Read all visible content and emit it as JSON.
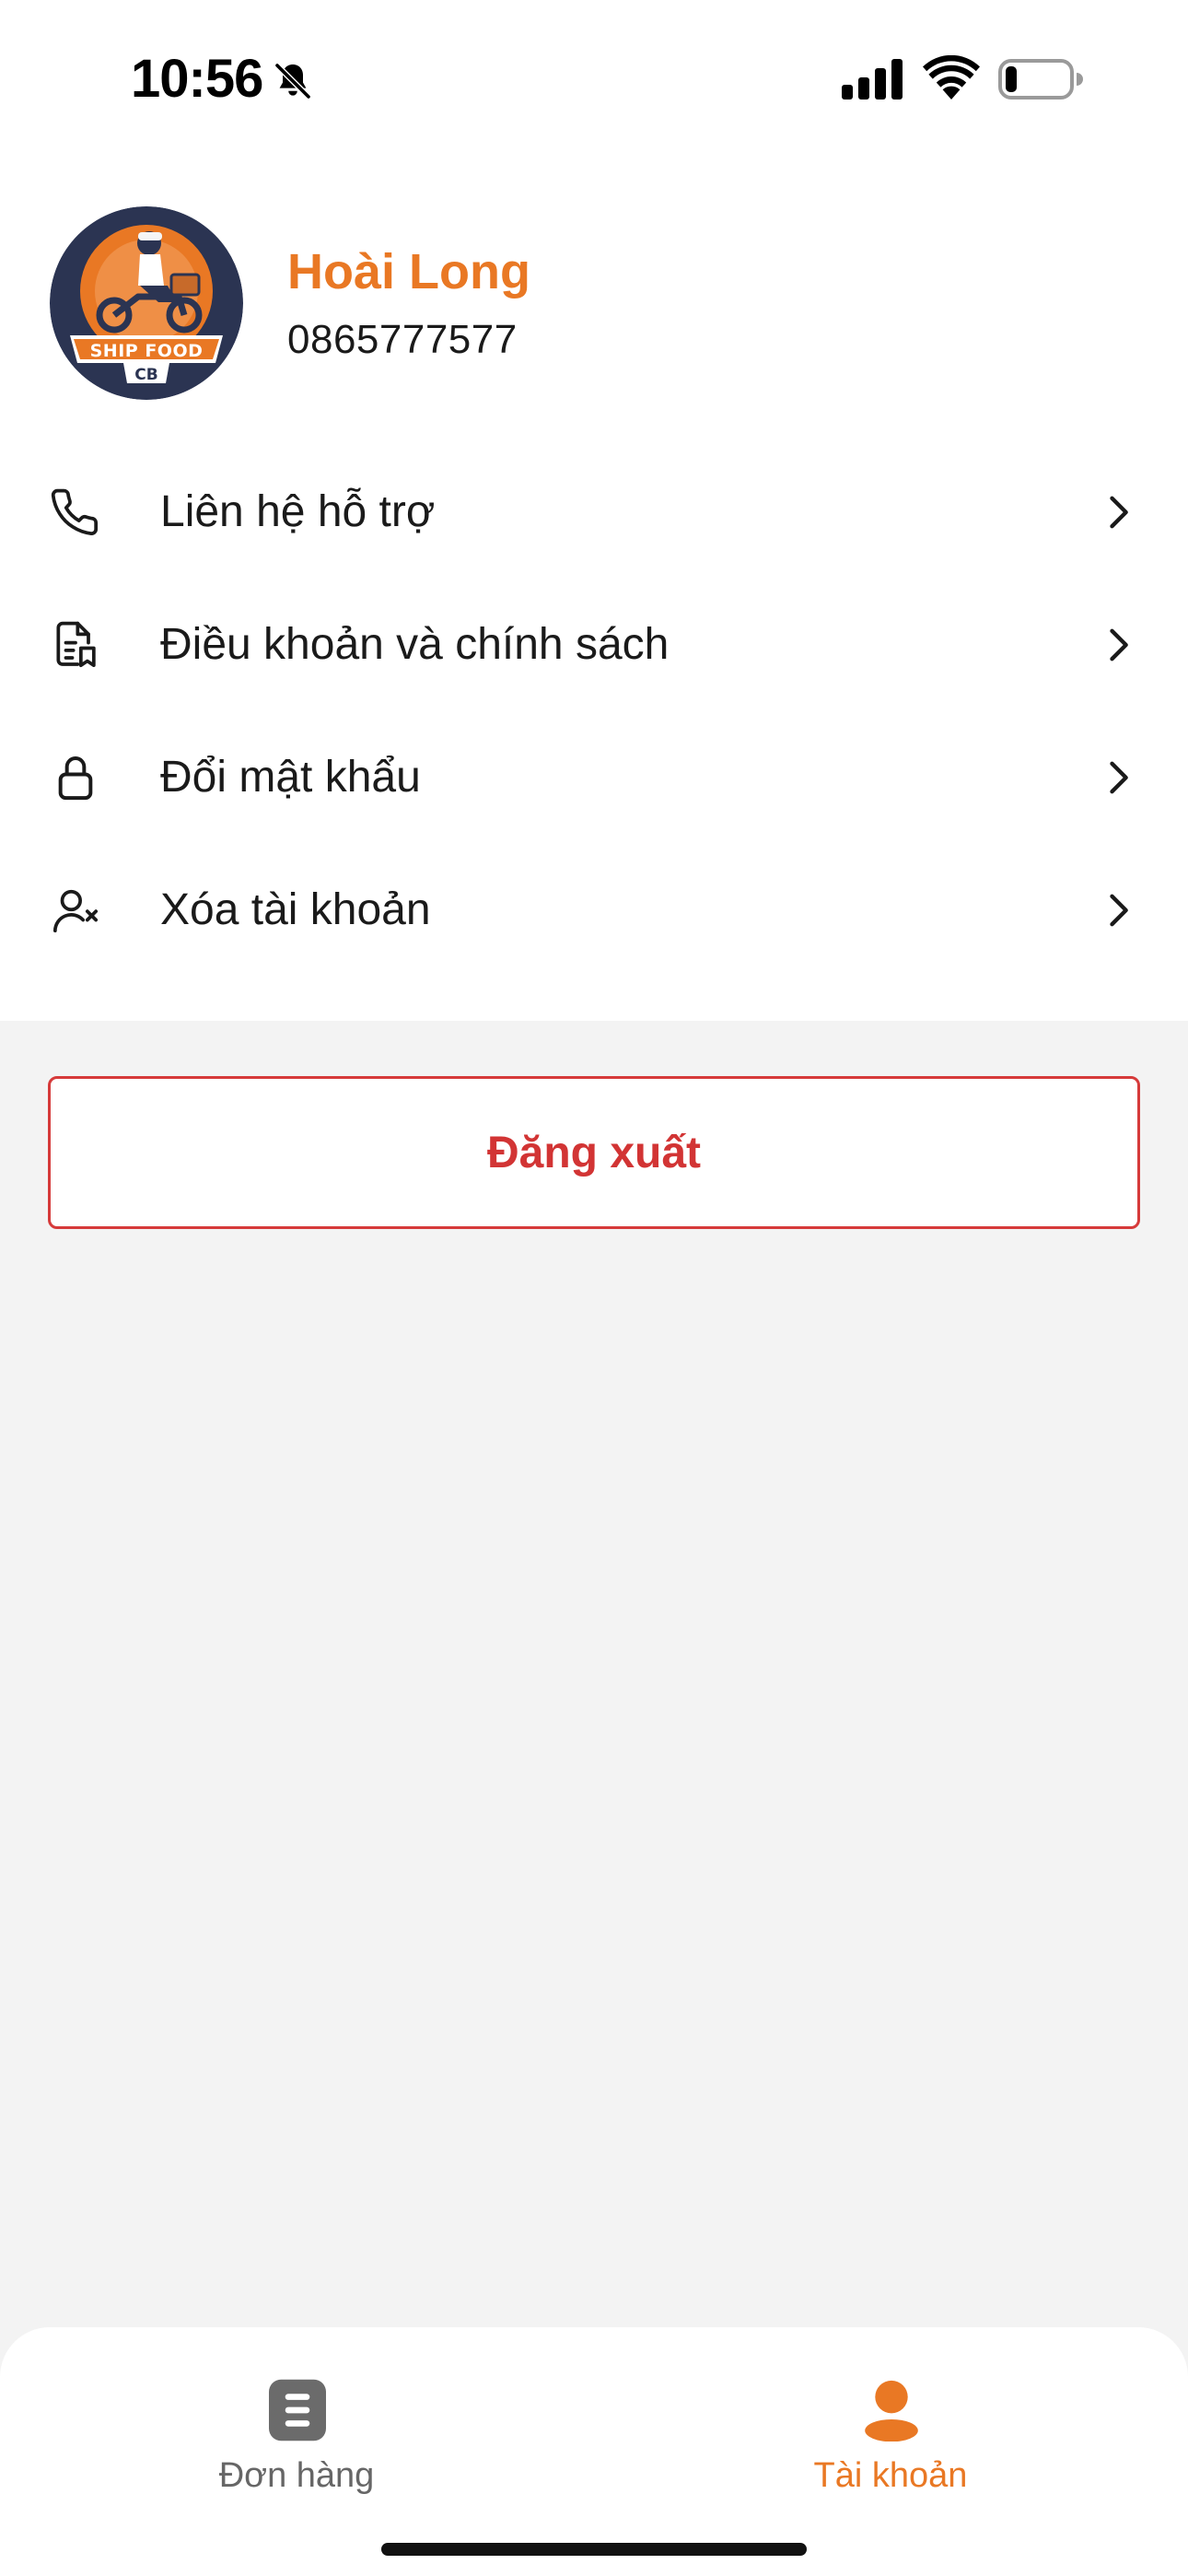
{
  "status_bar": {
    "time": "10:56",
    "icons": [
      "bell-off-icon",
      "cellular-signal-icon",
      "wifi-icon",
      "battery-icon"
    ]
  },
  "profile": {
    "name": "Hoài Long",
    "phone": "0865777577",
    "avatar_logo_text": "SHIP FOOD CB"
  },
  "menu": {
    "items": [
      {
        "label": "Liên hệ hỗ trợ",
        "icon": "phone-icon"
      },
      {
        "label": "Điều khoản và chính sách",
        "icon": "document-bookmark-icon"
      },
      {
        "label": "Đổi mật khẩu",
        "icon": "lock-icon"
      },
      {
        "label": "Xóa tài khoản",
        "icon": "user-remove-icon"
      }
    ]
  },
  "logout": {
    "label": "Đăng xuất"
  },
  "tabs": [
    {
      "label": "Đơn hàng",
      "icon": "orders-list-icon",
      "active": false
    },
    {
      "label": "Tài khoản",
      "icon": "user-icon",
      "active": true
    }
  ],
  "colors": {
    "accent": "#e97824",
    "danger": "#d23434",
    "background": "#f3f3f3",
    "card": "#ffffff",
    "avatar_bg": "#2b3452"
  }
}
